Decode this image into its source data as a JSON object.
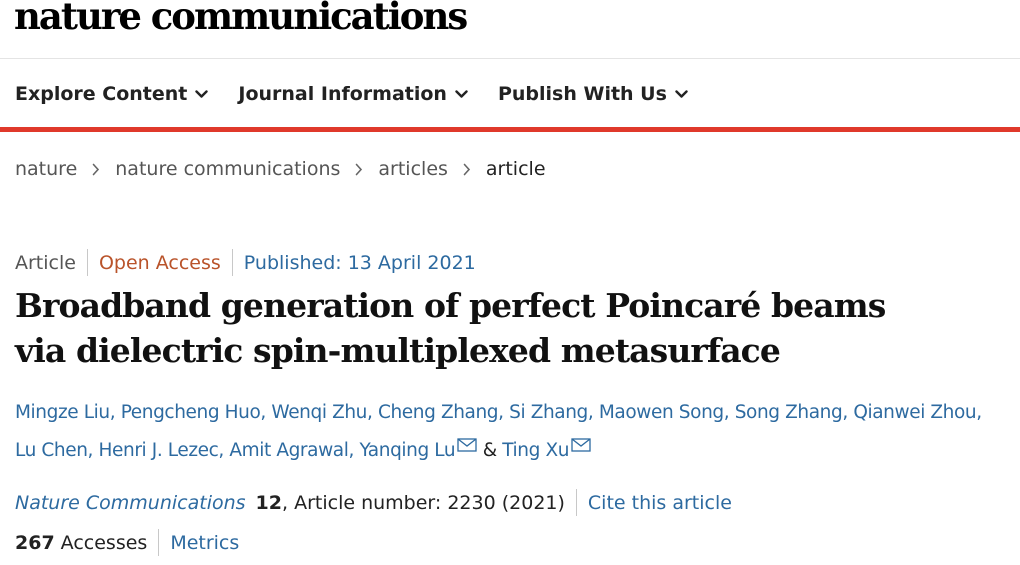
{
  "logo": "nature communications",
  "nav": [
    {
      "label": "Explore Content"
    },
    {
      "label": "Journal Information"
    },
    {
      "label": "Publish With Us"
    }
  ],
  "breadcrumb": [
    "nature",
    "nature communications",
    "articles",
    "article"
  ],
  "meta": {
    "type": "Article",
    "access": "Open Access",
    "published": "Published: 13 April 2021"
  },
  "title_lines": [
    "Broadband generation of perfect Poincaré beams",
    "via dielectric spin-multiplexed metasurface"
  ],
  "authors": [
    "Mingze Liu",
    "Pengcheng Huo",
    "Wenqi Zhu",
    "Cheng Zhang",
    "Si Zhang",
    "Maowen Song",
    "Song Zhang",
    "Qianwei Zhou",
    "Lu Chen",
    "Henri J. Lezec",
    "Amit Agrawal",
    "Yanqing Lu",
    "Ting Xu"
  ],
  "author_separator": ",",
  "author_and": "&",
  "citation": {
    "journal": "Nature Communications",
    "volume": "12",
    "article_number": ", Article number: 2230 (2021)",
    "cite_link": "Cite this article"
  },
  "metrics": {
    "accesses_count": "267",
    "accesses_label": "Accesses",
    "metrics_link": "Metrics"
  },
  "colors": {
    "link_blue": "#2d6aa0",
    "open_access": "#b9532a",
    "accent_red": "#e0392b"
  }
}
